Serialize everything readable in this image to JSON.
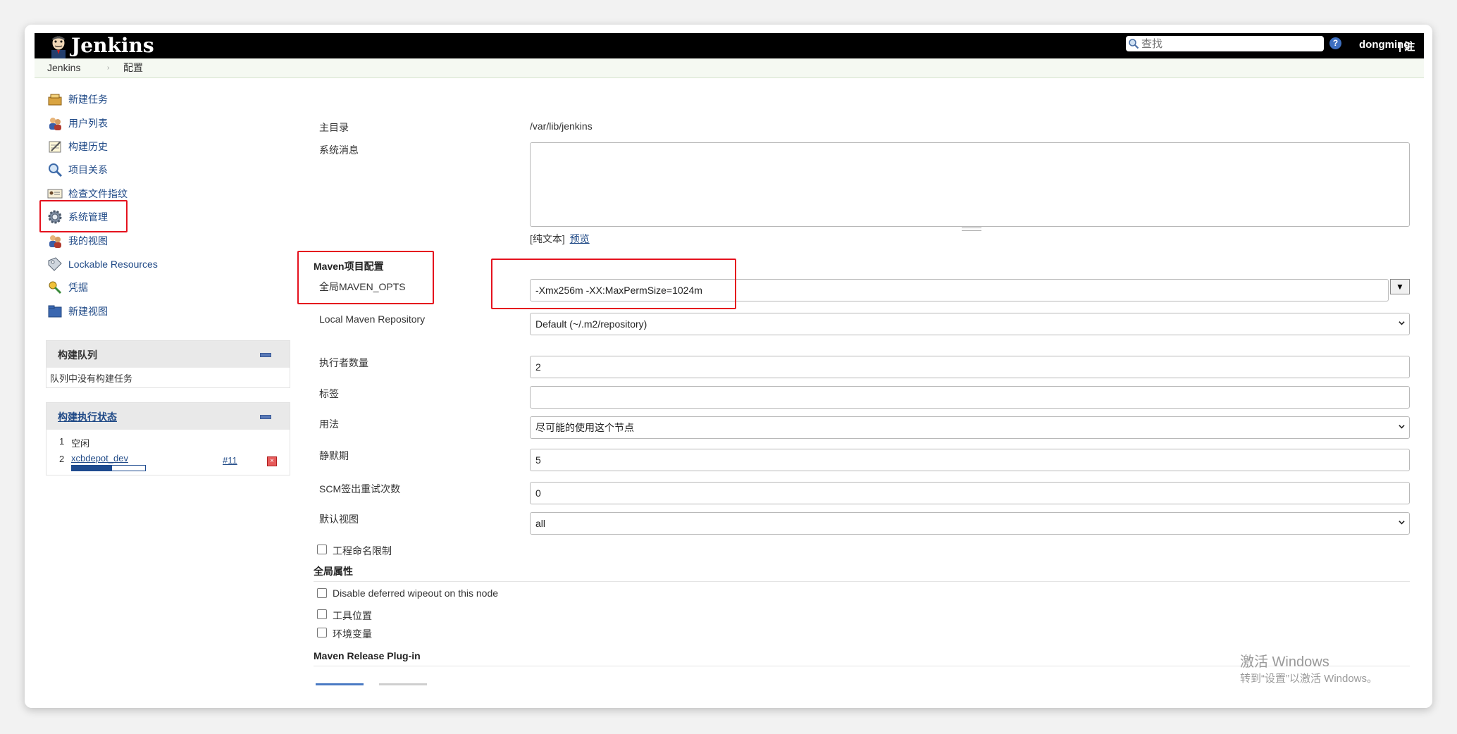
{
  "header": {
    "app_name": "Jenkins",
    "search_placeholder": "查找",
    "help_label": "?",
    "username": "dongming",
    "logout_label": "| 注"
  },
  "breadcrumb": {
    "home": "Jenkins",
    "separator": "›",
    "current": "配置"
  },
  "sidebar": {
    "tasks": [
      {
        "label": "新建任务",
        "icon": "new-job-icon"
      },
      {
        "label": "用户列表",
        "icon": "people-icon"
      },
      {
        "label": "构建历史",
        "icon": "notepad-icon"
      },
      {
        "label": "项目关系",
        "icon": "search-icon"
      },
      {
        "label": "检查文件指纹",
        "icon": "fingerprint-icon"
      },
      {
        "label": "系统管理",
        "icon": "gear-icon"
      },
      {
        "label": "我的视图",
        "icon": "user-icon"
      },
      {
        "label": "Lockable Resources",
        "icon": "lock-icon"
      },
      {
        "label": "凭据",
        "icon": "credentials-icon"
      },
      {
        "label": "新建视图",
        "icon": "folder-icon"
      }
    ],
    "build_queue": {
      "title": "构建队列",
      "empty_text": "队列中没有构建任务"
    },
    "executors": {
      "title": "构建执行状态",
      "rows": [
        {
          "index": "1",
          "status": "空闲"
        },
        {
          "index": "2",
          "job": "xcbdepot_dev",
          "build": "#11",
          "progress": 0.55
        }
      ]
    }
  },
  "form": {
    "home_dir_label": "主目录",
    "home_dir_value": "/var/lib/jenkins",
    "system_message_label": "系统消息",
    "system_message_value": "",
    "markup_prefix": "[纯文本]",
    "preview_link": "预览",
    "maven_section_title": "Maven项目配置",
    "maven_opts_label": "全局MAVEN_OPTS",
    "maven_opts_value": "-Xmx256m -XX:MaxPermSize=1024m",
    "local_repo_label": "Local Maven Repository",
    "local_repo_value": "Default (~/.m2/repository)",
    "executors_label": "执行者数量",
    "executors_value": "2",
    "labels_label": "标签",
    "labels_value": "",
    "usage_label": "用法",
    "usage_value": "尽可能的使用这个节点",
    "quiet_period_label": "静默期",
    "quiet_period_value": "5",
    "scm_retry_label": "SCM签出重试次数",
    "scm_retry_value": "0",
    "default_view_label": "默认视图",
    "default_view_value": "all",
    "project_naming_label": "工程命名限制",
    "global_props_title": "全局属性",
    "disable_wipeout_label": "Disable deferred wipeout on this node",
    "tool_locations_label": "工具位置",
    "env_vars_label": "环境变量",
    "maven_release_title": "Maven Release Plug-in"
  },
  "watermark": {
    "line1": "激活 Windows",
    "line2": "转到“设置”以激活 Windows。"
  },
  "colors": {
    "header_bg": "#000000",
    "link": "#204a87",
    "highlight_red": "#e5121e",
    "progress": "#1e4b8f"
  }
}
